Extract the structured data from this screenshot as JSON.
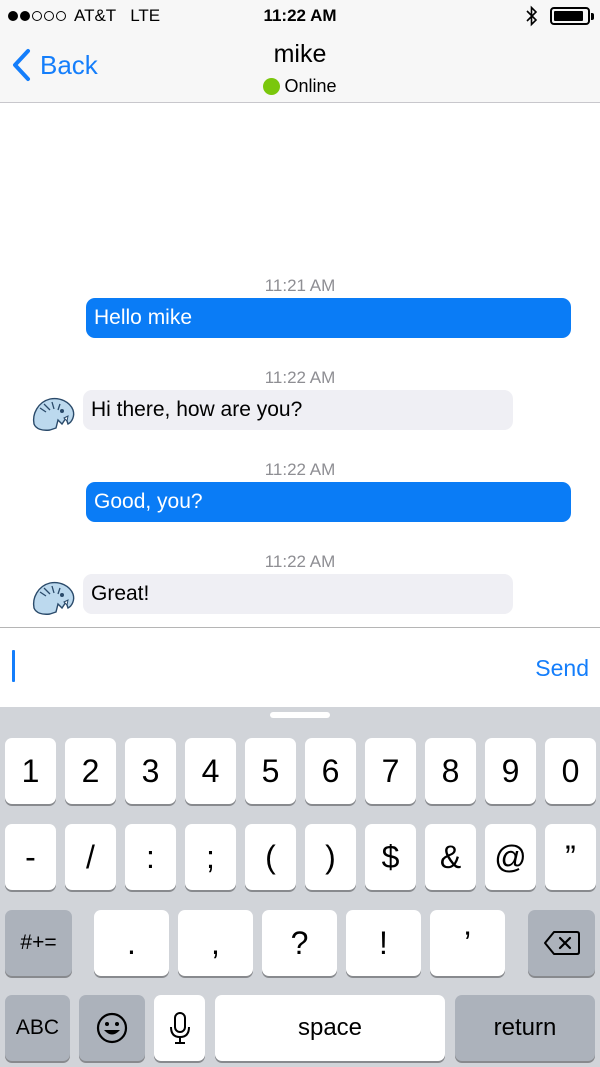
{
  "status_bar": {
    "carrier": "AT&T",
    "network": "LTE",
    "time": "11:22 AM",
    "signal_bars_filled": 2,
    "signal_bars_total": 5,
    "battery_level": 0.9,
    "icons": [
      "signal-icon",
      "bluetooth-icon",
      "battery-icon"
    ]
  },
  "nav": {
    "back_label": "Back",
    "title": "mike",
    "status": "Online",
    "status_color": "#7ac70c",
    "accent": "#147efb"
  },
  "messages": [
    {
      "time": "11:21 AM",
      "text": "Hello mike",
      "direction": "outgoing"
    },
    {
      "time": "11:22 AM",
      "text": "Hi there, how are you?",
      "direction": "incoming"
    },
    {
      "time": "11:22 AM",
      "text": "Good, you?",
      "direction": "outgoing"
    },
    {
      "time": "11:22 AM",
      "text": "Great!",
      "direction": "incoming"
    }
  ],
  "input": {
    "value": "",
    "send_label": "Send"
  },
  "keyboard": {
    "row1": [
      "1",
      "2",
      "3",
      "4",
      "5",
      "6",
      "7",
      "8",
      "9",
      "0"
    ],
    "row2": [
      "-",
      "/",
      ":",
      ";",
      "(",
      ")",
      "$",
      "&",
      "@",
      "”"
    ],
    "row3_left": "#+=",
    "row3": [
      ".",
      ",",
      "?",
      "!",
      "’"
    ],
    "row3_right_icon": "backspace-icon",
    "row4_abc": "ABC",
    "row4_emoji_icon": "emoji-icon",
    "row4_mic_icon": "microphone-icon",
    "space": "space",
    "return": "return"
  }
}
